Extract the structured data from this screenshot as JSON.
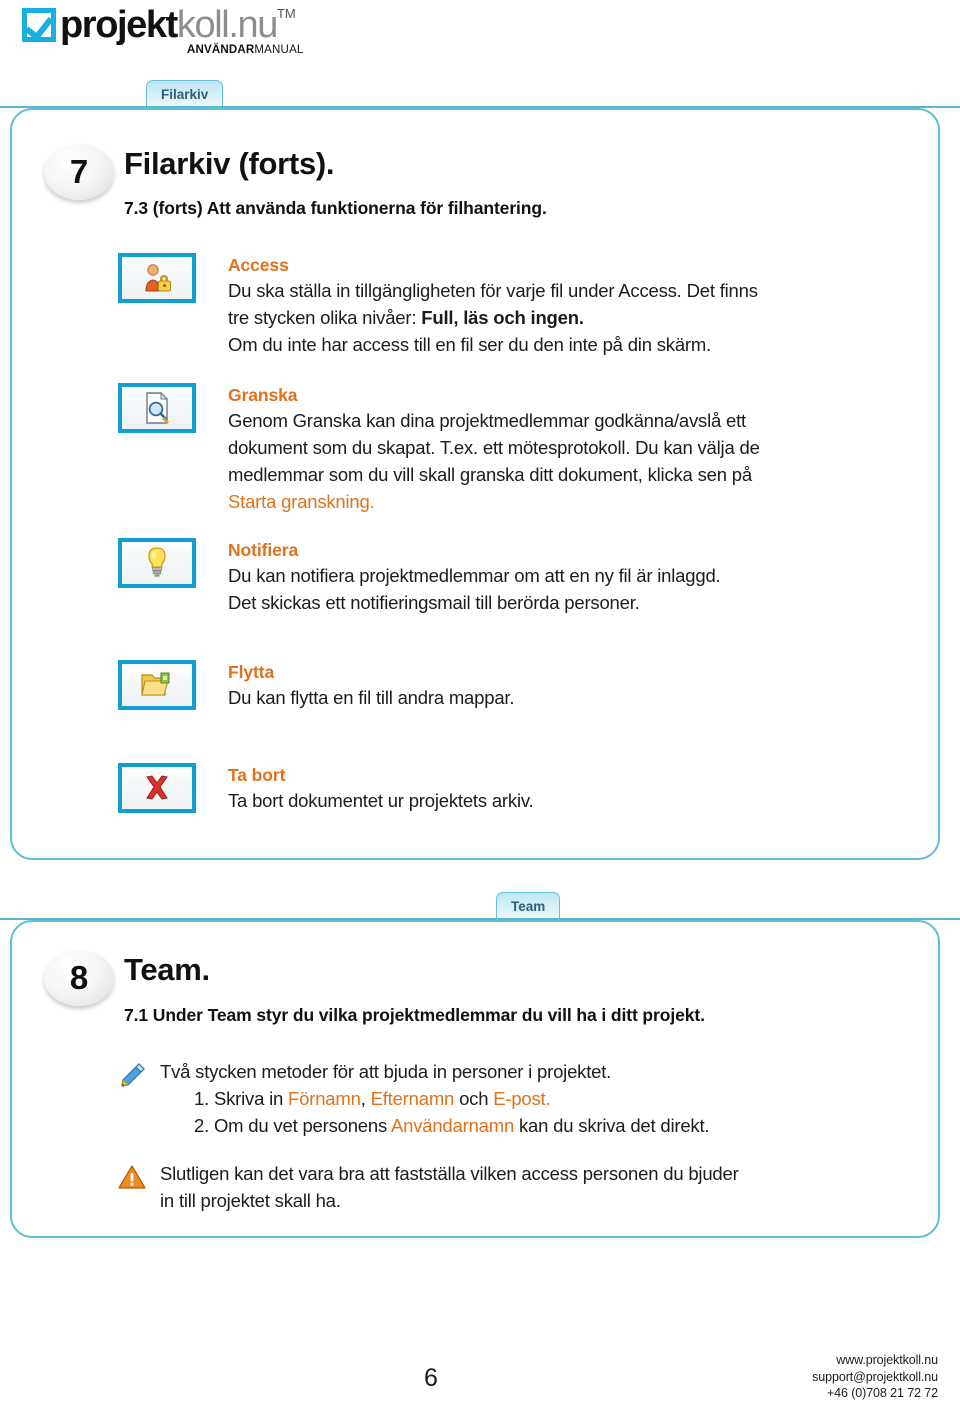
{
  "logo": {
    "word_primary": "projekt",
    "word_secondary": "koll.nu",
    "trademark": "TM",
    "subtitle_bold": "ANVÄNDAR",
    "subtitle_regular": "MANUAL"
  },
  "tabs": {
    "filarkiv": "Filarkiv",
    "team": "Team"
  },
  "sections": [
    {
      "number": "7",
      "title": "Filarkiv (forts).",
      "subtitle": "7.3 (forts) Att använda funktionerna för filhantering."
    },
    {
      "number": "8",
      "title": "Team.",
      "subtitle": "7.1 Under Team styr du vilka projektmedlemmar du vill ha i ditt projekt."
    }
  ],
  "features": [
    {
      "icon": "user-lock-icon",
      "heading": "Access",
      "line1": "Du ska ställa in tillgängligheten för varje fil under Access. Det finns",
      "line2_prefix": "tre stycken olika nivåer: ",
      "line2_bold": "Full, läs och ingen.",
      "line3": "Om du inte har access till en fil ser du den inte på din skärm."
    },
    {
      "icon": "document-search-icon",
      "heading": "Granska",
      "line1": "Genom Granska kan dina projektmedlemmar godkänna/avslå ett",
      "line2": "dokument som du skapat. T.ex. ett mötesprotokoll. Du kan välja de",
      "line3": "medlemmar som du vill skall granska ditt dokument, klicka sen på",
      "line4_orange": "Starta granskning."
    },
    {
      "icon": "lightbulb-icon",
      "heading": "Notifiera",
      "line1": "Du kan notifiera projektmedlemmar om att en ny fil är inlaggd.",
      "line2": "Det skickas ett notifieringsmail till berörda personer."
    },
    {
      "icon": "folder-move-icon",
      "heading": "Flytta",
      "line1": "Du kan flytta en fil till andra mappar."
    },
    {
      "icon": "red-cross-delete-icon",
      "heading": "Ta bort",
      "line1": "Ta bort dokumentet ur projektets arkiv."
    }
  ],
  "team_notes": {
    "pencil_icon": "pencil-icon",
    "invite_intro": "Två stycken metoder för att bjuda in personer i projektet.",
    "item1_prefix": "1. Skriva in ",
    "item1_o1": "Förnamn",
    "item1_mid1": ", ",
    "item1_o2": "Efternamn",
    "item1_mid2": " och ",
    "item1_o3": "E-post.",
    "item2_prefix": "2. Om du vet personens ",
    "item2_orange": "Användarnamn",
    "item2_suffix": " kan du skriva det direkt.",
    "warning_icon": "warning-triangle-icon",
    "warning_line1": "Slutligen kan det vara bra att fastställa vilken access personen du bjuder",
    "warning_line2": "in till projektet skall ha."
  },
  "footer": {
    "page_number": "6",
    "website": "www.projektkoll.nu",
    "email": "support@projektkoll.nu",
    "phone": "+46 (0)708 21 72 72"
  },
  "colors": {
    "brand_blue": "#17aee0",
    "panel_border": "#5fbfd2",
    "accent_orange": "#e1711a",
    "tab_text": "#2c5f78"
  }
}
